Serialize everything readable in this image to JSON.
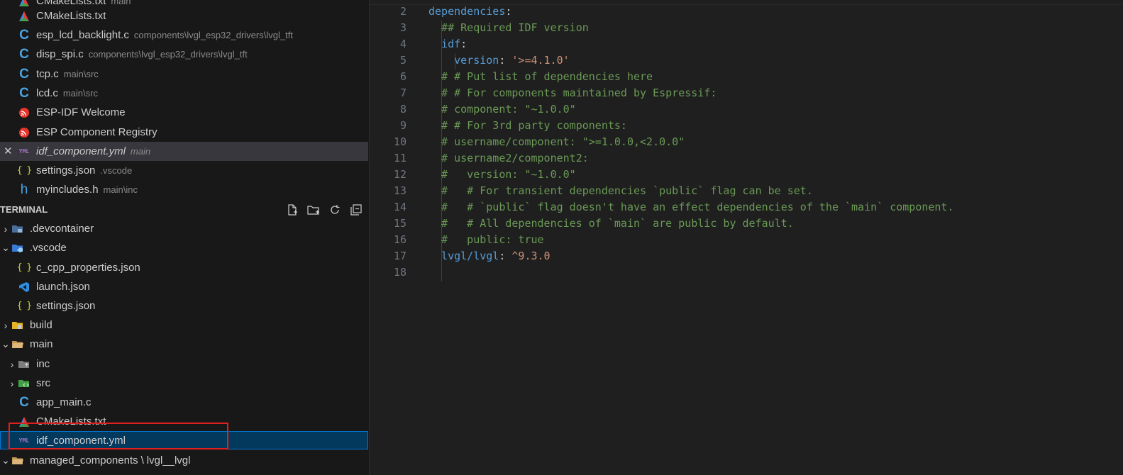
{
  "open_editors": [
    {
      "label": "CMakeLists.txt",
      "desc": "main",
      "icon": "cmake-icon"
    },
    {
      "label": "CMakeLists.txt",
      "desc": "",
      "icon": "cmake-icon"
    },
    {
      "label": "esp_lcd_backlight.c",
      "desc": "components\\lvgl_esp32_drivers\\lvgl_tft",
      "icon": "c-file-icon"
    },
    {
      "label": "disp_spi.c",
      "desc": "components\\lvgl_esp32_drivers\\lvgl_tft",
      "icon": "c-file-icon"
    },
    {
      "label": "tcp.c",
      "desc": "main\\src",
      "icon": "c-file-icon"
    },
    {
      "label": "lcd.c",
      "desc": "main\\src",
      "icon": "c-file-icon"
    },
    {
      "label": "ESP-IDF Welcome",
      "desc": "",
      "icon": "espressif-icon"
    },
    {
      "label": "ESP Component Registry",
      "desc": "",
      "icon": "espressif-icon"
    },
    {
      "label": "idf_component.yml",
      "desc": "main",
      "icon": "yaml-icon",
      "close": "✕"
    },
    {
      "label": "settings.json",
      "desc": ".vscode",
      "icon": "json-icon"
    },
    {
      "label": "myincludes.h",
      "desc": "main\\inc",
      "icon": "h-file-icon"
    }
  ],
  "section": {
    "title": "TERMINAL"
  },
  "tree": [
    {
      "label": ".devcontainer",
      "chevron": "›",
      "icon": "folder-devcontainer-icon"
    },
    {
      "label": ".vscode",
      "chevron": "⌄",
      "icon": "folder-vscode-icon"
    },
    {
      "label": "c_cpp_properties.json",
      "chevron": "",
      "icon": "json-icon"
    },
    {
      "label": "launch.json",
      "chevron": "",
      "icon": "vscode-icon"
    },
    {
      "label": "settings.json",
      "chevron": "",
      "icon": "json-icon"
    },
    {
      "label": "build",
      "chevron": "›",
      "icon": "folder-build-icon"
    },
    {
      "label": "main",
      "chevron": "⌄",
      "icon": "folder-open-icon"
    },
    {
      "label": "inc",
      "chevron": "›",
      "icon": "folder-include-icon"
    },
    {
      "label": "src",
      "chevron": "›",
      "icon": "folder-src-icon"
    },
    {
      "label": "app_main.c",
      "chevron": "",
      "icon": "c-file-icon"
    },
    {
      "label": "CMakeLists.txt",
      "chevron": "",
      "icon": "cmake-icon"
    },
    {
      "label": "idf_component.yml",
      "chevron": "",
      "icon": "yaml-icon"
    },
    {
      "label": "managed_components",
      "desc": "lvgl__lvgl",
      "chevron": "⌄",
      "icon": "folder-open-icon"
    }
  ],
  "icon_glyphs": {
    "c": "C",
    "h": "h",
    "json": "{ }",
    "yml": "YML"
  },
  "editor": {
    "lines": [
      {
        "n": "2",
        "tokens": [
          {
            "t": "dependencies",
            "c": "k"
          },
          {
            "t": ":",
            "c": "p"
          }
        ]
      },
      {
        "n": "3",
        "tokens": [
          {
            "t": "  ## Required IDF version",
            "c": "c"
          }
        ]
      },
      {
        "n": "4",
        "tokens": [
          {
            "t": "  idf",
            "c": "k"
          },
          {
            "t": ":",
            "c": "p"
          }
        ]
      },
      {
        "n": "5",
        "tokens": [
          {
            "t": "    version",
            "c": "k"
          },
          {
            "t": ": ",
            "c": "p"
          },
          {
            "t": "'>=4.1.0'",
            "c": "s"
          }
        ]
      },
      {
        "n": "6",
        "tokens": [
          {
            "t": "  # # Put list of dependencies here",
            "c": "c"
          }
        ]
      },
      {
        "n": "7",
        "tokens": [
          {
            "t": "  # # For components maintained by Espressif:",
            "c": "c"
          }
        ]
      },
      {
        "n": "8",
        "tokens": [
          {
            "t": "  # component: \"~1.0.0\"",
            "c": "c"
          }
        ]
      },
      {
        "n": "9",
        "tokens": [
          {
            "t": "  # # For 3rd party components:",
            "c": "c"
          }
        ]
      },
      {
        "n": "10",
        "tokens": [
          {
            "t": "  # username/component: \">=1.0.0,<2.0.0\"",
            "c": "c"
          }
        ]
      },
      {
        "n": "11",
        "tokens": [
          {
            "t": "  # username2/component2:",
            "c": "c"
          }
        ]
      },
      {
        "n": "12",
        "tokens": [
          {
            "t": "  #   version: \"~1.0.0\"",
            "c": "c"
          }
        ]
      },
      {
        "n": "13",
        "tokens": [
          {
            "t": "  #   # For transient dependencies `public` flag can be set.",
            "c": "c"
          }
        ]
      },
      {
        "n": "14",
        "tokens": [
          {
            "t": "  #   # `public` flag doesn't have an effect dependencies of the `main` component.",
            "c": "c"
          }
        ]
      },
      {
        "n": "15",
        "tokens": [
          {
            "t": "  #   # All dependencies of `main` are public by default.",
            "c": "c"
          }
        ]
      },
      {
        "n": "16",
        "tokens": [
          {
            "t": "  #   public: true",
            "c": "c"
          }
        ]
      },
      {
        "n": "17",
        "tokens": [
          {
            "t": "  lvgl/lvgl",
            "c": "k"
          },
          {
            "t": ": ",
            "c": "p"
          },
          {
            "t": "^9.3.0",
            "c": "s"
          }
        ]
      },
      {
        "n": "18",
        "tokens": []
      }
    ]
  },
  "colors": {
    "keyword": "#569cd6",
    "string": "#ce9178",
    "comment": "#6a9955",
    "selection": "#04395e",
    "highlight_box": "#e02020"
  }
}
